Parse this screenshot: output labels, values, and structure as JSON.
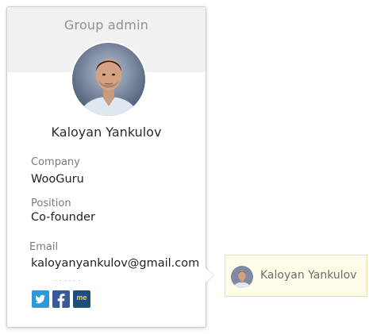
{
  "card": {
    "role_label": "Group admin",
    "name": "Kaloyan Yankulov",
    "company_label": "Company",
    "company_value": "WooGuru",
    "position_label": "Position",
    "position_value": "Co-founder",
    "email_label": "Email",
    "email_value": "kaloyanyankulov@gmail.com",
    "social_links": [
      {
        "network": "twitter",
        "icon": "twitter-icon",
        "color": "#2c9ad8"
      },
      {
        "network": "facebook",
        "icon": "facebook-icon",
        "color": "#3b5998"
      },
      {
        "network": "me",
        "icon": "me-icon",
        "label": "me",
        "color": "#1c4f7a"
      }
    ]
  },
  "chip": {
    "name": "Kaloyan Yankulov",
    "background": "#fffdea",
    "border": "#e7e0a8"
  }
}
